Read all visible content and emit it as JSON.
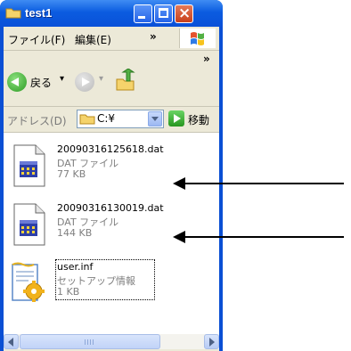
{
  "window": {
    "title": "test1"
  },
  "menubar": {
    "file": "ファイル(F)",
    "edit": "編集(E)",
    "more": "»"
  },
  "toolbar": {
    "back_label": "戻る",
    "back_dropdown": "▾",
    "forward_dropdown": "▾",
    "more": "»"
  },
  "addressbar": {
    "label": "アドレス(D)",
    "value": "C:¥",
    "go_label": "移動"
  },
  "files": [
    {
      "name": "20090316125618.dat",
      "type": "DAT ファイル",
      "size": "77 KB",
      "icon": "dat-file-icon"
    },
    {
      "name": "20090316130019.dat",
      "type": "DAT ファイル",
      "size": "144 KB",
      "icon": "dat-file-icon"
    },
    {
      "name": "user.inf",
      "type": "セットアップ情報",
      "size": "1 KB",
      "icon": "setup-info-icon",
      "selected_focus": true
    }
  ],
  "colors": {
    "titlebar": "#0a50d8",
    "window_bg": "#ece9d8",
    "close_button": "#c9401b",
    "go_button": "#27961f"
  }
}
